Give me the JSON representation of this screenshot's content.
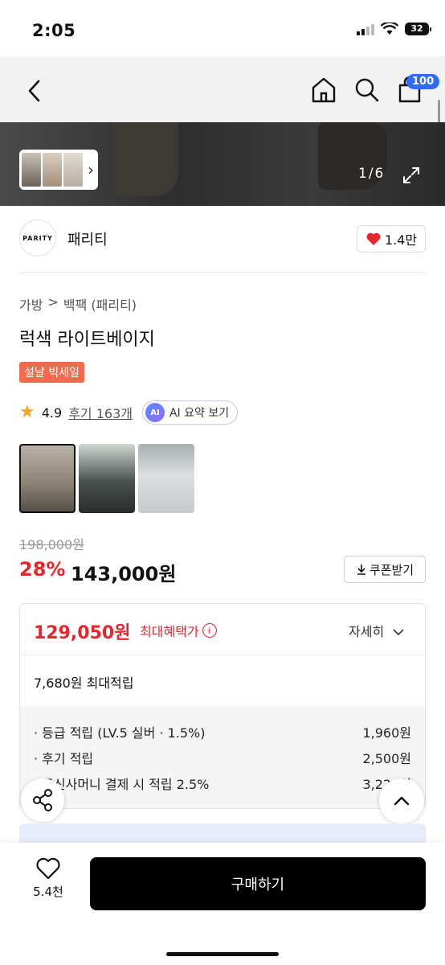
{
  "status_bar": {
    "time": "2:05",
    "battery": "32"
  },
  "nav": {
    "cart_count": "100"
  },
  "hero": {
    "counter": "1/6"
  },
  "brand": {
    "logo_text": "PARITY",
    "name": "패리티",
    "likes": "1.4만"
  },
  "breadcrumb": [
    "가방",
    ">",
    "백팩 (패리티)"
  ],
  "product": {
    "title": "럭색 라이트베이지",
    "sale_badge": "설날 빅세일",
    "rating": "4.9",
    "reviews": "후기 163개",
    "ai_icon": "AI",
    "ai_summary": "AI 요약 보기",
    "original_price": "198,000원",
    "discount": "28%",
    "price": "143,000원",
    "coupon": "쿠폰받기"
  },
  "benefits": {
    "max_price": "129,050원",
    "max_label": "최대혜택가",
    "detail": "자세히",
    "points": "7,680원 최대적립",
    "rows": [
      {
        "label": "· 등급 적립 (LV.5 실버 · 1.5%)",
        "value": "1,960원"
      },
      {
        "label": "· 후기 적립",
        "value": "2,500원"
      },
      {
        "label": "· 무신사머니 결제 시 적립 2.5%",
        "value": "3,220원"
      }
    ]
  },
  "bottom": {
    "wish_count": "5.4천",
    "buy": "구매하기"
  },
  "colors": {
    "accent_red": "#e6262d",
    "sale_badge": "#f26b4f",
    "cart_badge": "#2e6bff"
  }
}
